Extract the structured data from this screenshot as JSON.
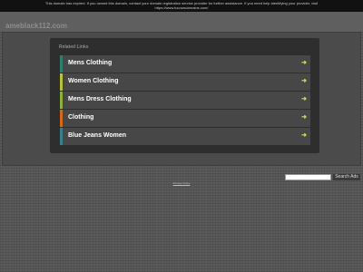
{
  "notice": {
    "line1": "This domain has expired. If you owned this domain, contact your domain registration service provider for further assistance. If you need help identifying your provider, visit",
    "line2": "https://www.tucowsdomains.com/"
  },
  "site": {
    "domain": "ameblack112.com"
  },
  "related": {
    "title": "Related Links",
    "items": [
      {
        "label": "Mens Clothing",
        "accent": "#2e7d6e"
      },
      {
        "label": "Women Clothing",
        "accent": "#b9c236"
      },
      {
        "label": "Mens Dress Clothing",
        "accent": "#8cb23c"
      },
      {
        "label": "Clothing",
        "accent": "#d2691e"
      },
      {
        "label": "Blue Jeans Women",
        "accent": "#3a7f8a"
      }
    ],
    "arrow_icon": "arrow-right-icon"
  },
  "search": {
    "button_label": "Search Ads",
    "value": ""
  },
  "footer": {
    "privacy_label": "Privacy Policy"
  }
}
